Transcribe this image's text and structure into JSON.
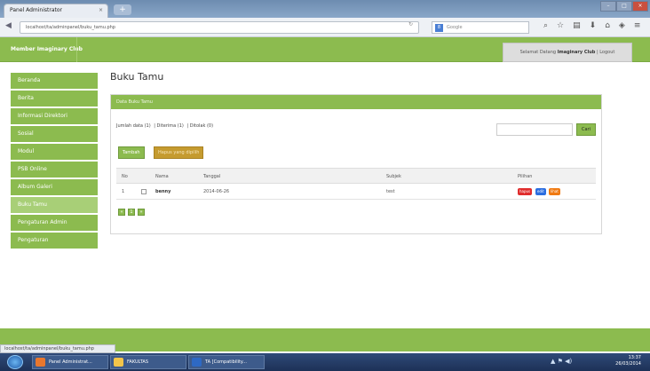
{
  "browser": {
    "tab_title": "Panel Administrator",
    "tab_close": "×",
    "new_tab": "+",
    "window_buttons": [
      "–",
      "□",
      "×"
    ],
    "url": "localhost/ta/adminpanel/buku_tamu.php",
    "search_engine": "8",
    "search_placeholder": "Google",
    "toolbar_icons": [
      "magnifier-icon",
      "star-icon",
      "home-icon",
      "download-icon",
      "home-icon",
      "bookmark-icon",
      "menu-icon"
    ],
    "status_url": "localhost/ta/adminpanel/buku_tamu.php"
  },
  "header": {
    "brand": "Member Imaginary Club",
    "welcome_prefix": "Selamat Datang",
    "welcome_user": "Imaginary Club",
    "logout": "| Logout"
  },
  "sidebar": {
    "items": [
      {
        "label": "Beranda"
      },
      {
        "label": "Berita"
      },
      {
        "label": "Informasi Direktori"
      },
      {
        "label": "Sosial"
      },
      {
        "label": "Modul"
      },
      {
        "label": "PSB Online"
      },
      {
        "label": "Album Galeri"
      },
      {
        "label": "Buku Tamu",
        "active": true
      },
      {
        "label": "Pengaturan Admin"
      },
      {
        "label": "Pengaturan"
      }
    ]
  },
  "main": {
    "title": "Buku Tamu",
    "panel_title": "Data Buku Tamu",
    "stats": {
      "jumlah": "Jumlah data (1)",
      "diterima": "| Diterima (1)",
      "ditolak": "| Ditolak (0)"
    },
    "search_button": "Cari",
    "btn_tambah": "Tambah",
    "btn_hapus_dipilih": "Hapus yang dipilih",
    "table": {
      "headers": [
        "No",
        "Nama",
        "Tanggal",
        "Subjek",
        "Pilihan"
      ],
      "rows": [
        {
          "no": "1",
          "nama": "benny",
          "tanggal": "2014-06-26",
          "subjek": "test",
          "actions": [
            "hapus",
            "edit",
            "lihat"
          ]
        }
      ]
    },
    "pager": [
      "«",
      "1",
      "»"
    ]
  },
  "taskbar": {
    "items": [
      "Panel Administrat...",
      "FAKULTAS",
      "TA [Compatibility..."
    ],
    "time": "13:37",
    "date": "26/03/2014"
  },
  "colors": {
    "accent": "#8cbb4f",
    "danger": "#e02c2c",
    "primary": "#2c6ee0",
    "warning": "#f07a12"
  }
}
